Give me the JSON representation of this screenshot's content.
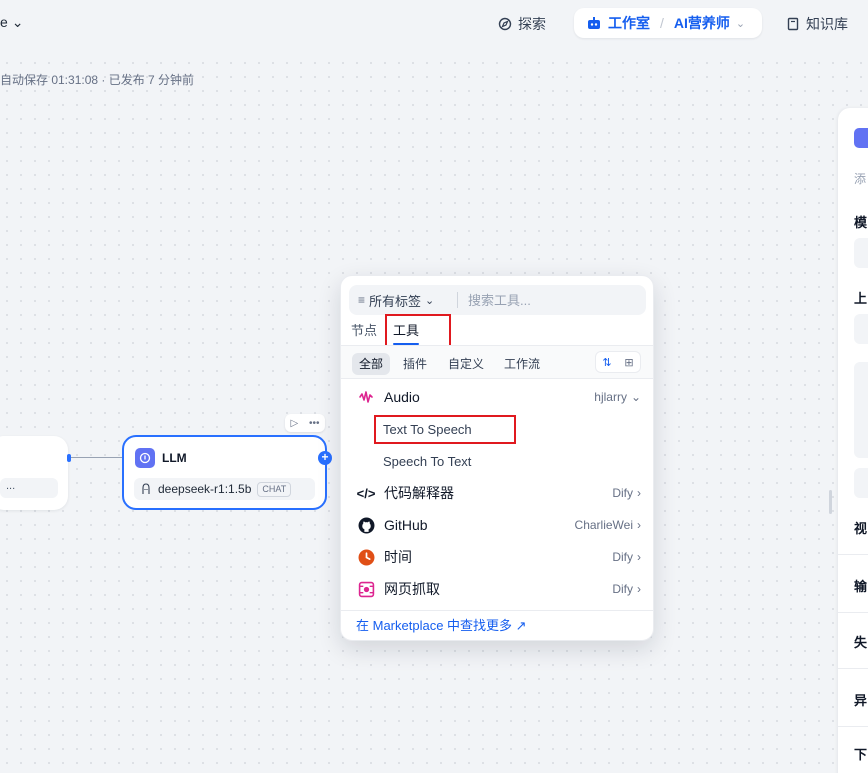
{
  "topbar": {
    "app_switch": "e",
    "explore": "探索",
    "studio": "工作室",
    "app_name": "AI营养师",
    "knowledge": "知识库"
  },
  "autosave": "自动保存 01:31:08 · 已发布 7 分钟前",
  "prev_node": {
    "field": "..."
  },
  "llm_node": {
    "title": "LLM",
    "model": "deepseek-r1:1.5b",
    "badge": "CHAT"
  },
  "popover": {
    "tag_filter": "所有标签",
    "search_placeholder": "搜索工具...",
    "tabs": [
      "节点",
      "工具"
    ],
    "categories": [
      "全部",
      "插件",
      "自定义",
      "工作流"
    ],
    "tools": [
      {
        "name": "Audio",
        "author": "hjlarry",
        "icon": "audio-icon",
        "color": "#dd2590"
      },
      {
        "name": "代码解释器",
        "author": "Dify",
        "icon": "code-icon",
        "color": "#101828"
      },
      {
        "name": "GitHub",
        "author": "CharlieWei",
        "icon": "github-icon",
        "color": "#101828"
      },
      {
        "name": "时间",
        "author": "Dify",
        "icon": "clock-icon",
        "color": "#e04f16"
      },
      {
        "name": "网页抓取",
        "author": "Dify",
        "icon": "webscraper-icon",
        "color": "#dd2590"
      }
    ],
    "audio_subtools": [
      "Text To Speech",
      "Speech To Text"
    ],
    "footer": "在 Marketplace 中查找更多 ↗"
  },
  "right_panel": {
    "labels": [
      "模",
      "上",
      "视",
      "输",
      "失",
      "异",
      "下"
    ],
    "sub_text": "添"
  },
  "colors": {
    "accent": "#155eef",
    "highlight": "#e0191f",
    "node_icon": "#6172f3"
  }
}
